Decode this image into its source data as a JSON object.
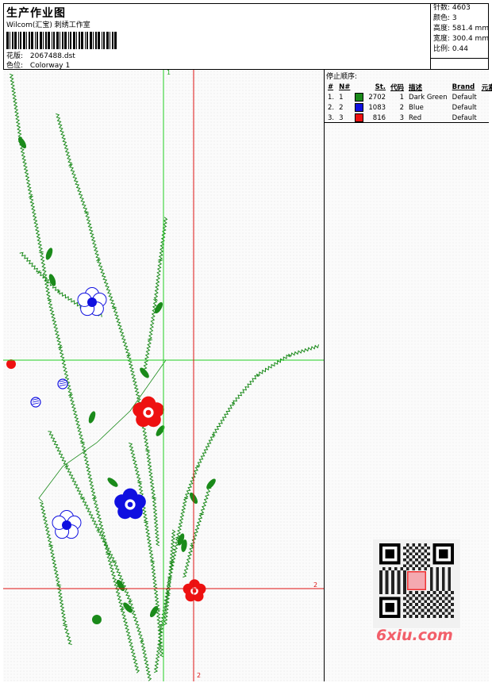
{
  "header": {
    "title": "生产作业图",
    "studio": "Wilcom(汇宝) 刺绣工作室",
    "design_label": "花版:",
    "design_value": "2067488.dst",
    "colorway_label": "色位:",
    "colorway_value": "Colorway 1"
  },
  "stats": {
    "stitches_label": "针数:",
    "stitches_value": "4603",
    "colors_label": "颜色:",
    "colors_value": "3",
    "height_label": "高度:",
    "height_value": "581.4 mm",
    "width_label": "宽度:",
    "width_value": "300.4 mm",
    "scale_label": "比例:",
    "scale_value": "0.44"
  },
  "legend": {
    "title": "停止顺序:",
    "columns": [
      "#",
      "N#",
      "St.",
      "代码",
      "描述",
      "Brand",
      "元素"
    ],
    "rows": [
      {
        "index": "1.",
        "n": "1",
        "stitches": "2702",
        "code": "1",
        "description": "Dark Green",
        "brand": "Default",
        "color": "#1a8a1a"
      },
      {
        "index": "2.",
        "n": "2",
        "stitches": "1083",
        "code": "2",
        "description": "Blue",
        "brand": "Default",
        "color": "#1010e0"
      },
      {
        "index": "3.",
        "n": "3",
        "stitches": "816",
        "code": "3",
        "description": "Red",
        "brand": "Default",
        "color": "#ee1111"
      }
    ]
  },
  "axis_labels": {
    "top": "1",
    "right": "2",
    "bottom": "2"
  },
  "watermark": "6xiu.com",
  "qr_stamp": "汉字图标",
  "colors": {
    "green": "#1a8a1a",
    "blue": "#1010e0",
    "red": "#ee1111",
    "green_guide": "#22cc22",
    "red_guide": "#dd1111"
  }
}
